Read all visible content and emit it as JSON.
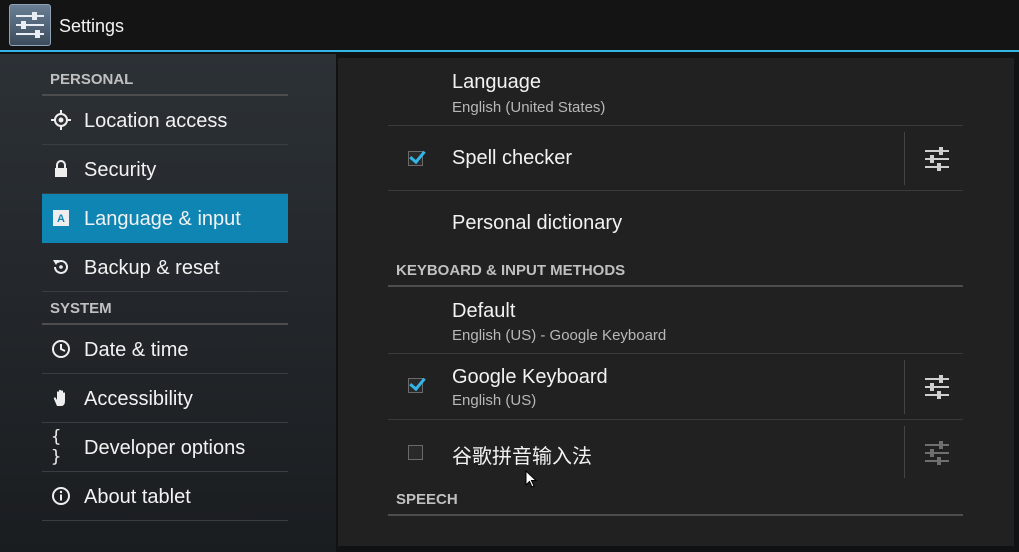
{
  "action_bar": {
    "title": "Settings",
    "app_icon": "settings-sliders-icon"
  },
  "sidebar": {
    "personal_header": "PERSONAL",
    "system_header": "SYSTEM",
    "personal_items": [
      {
        "label": "Location access",
        "icon": "location-icon"
      },
      {
        "label": "Security",
        "icon": "lock-icon"
      },
      {
        "label": "Language & input",
        "icon": "language-icon",
        "selected": true
      },
      {
        "label": "Backup & reset",
        "icon": "backup-icon"
      }
    ],
    "system_items": [
      {
        "label": "Date & time",
        "icon": "clock-icon"
      },
      {
        "label": "Accessibility",
        "icon": "hand-icon"
      },
      {
        "label": "Developer options",
        "icon": "braces-icon",
        "glyph": "{ }"
      },
      {
        "label": "About tablet",
        "icon": "info-icon"
      }
    ]
  },
  "content": {
    "language": {
      "title": "Language",
      "summary": "English (United States)"
    },
    "spell_checker": {
      "title": "Spell checker",
      "checked": true
    },
    "personal_dictionary": {
      "title": "Personal dictionary"
    },
    "keyboard_section": "KEYBOARD & INPUT METHODS",
    "default_keyboard": {
      "title": "Default",
      "summary": "English (US) - Google Keyboard"
    },
    "google_keyboard": {
      "title": "Google Keyboard",
      "summary": "English (US)",
      "checked": true
    },
    "pinyin": {
      "title": "谷歌拼音输入法",
      "checked": false
    },
    "speech_section": "SPEECH"
  },
  "colors": {
    "accent": "#33b5e5",
    "selected_bg": "#0e85b3"
  }
}
